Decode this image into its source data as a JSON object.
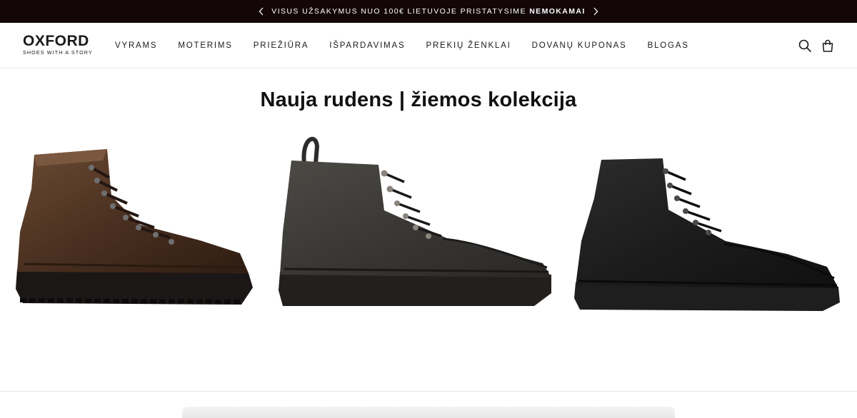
{
  "announcement": {
    "text": "VISUS UŽSAKYMUS NUO 100€ LIETUVOJE PRISTATYSIME ",
    "highlight": "NEMOKAMAI",
    "prev_icon": "chevron-left-icon",
    "next_icon": "chevron-right-icon",
    "background": "#120608"
  },
  "logo": {
    "name": "OXFORD",
    "tagline": "SHOES WITH A STORY"
  },
  "nav": {
    "items": [
      {
        "label": "VYRAMS"
      },
      {
        "label": "MOTERIMS"
      },
      {
        "label": "PRIEŽIŪRA"
      },
      {
        "label": "IŠPARDAVIMAS"
      },
      {
        "label": "PREKIŲ ŽENKLAI"
      },
      {
        "label": "DOVANŲ KUPONAS"
      },
      {
        "label": "BLOGAS"
      }
    ]
  },
  "header_icons": {
    "search": "search-icon",
    "cart": "shopping-bag-icon"
  },
  "main": {
    "headline": "Nauja rudens | žiemos kolekcija",
    "products": [
      {
        "image": "brown-leather-hiking-boot",
        "color": "#4a3020"
      },
      {
        "image": "dark-grey-suede-lace-up-boot",
        "color": "#3a3835"
      },
      {
        "image": "black-leather-lace-up-boot",
        "color": "#1c1c1c"
      }
    ]
  }
}
